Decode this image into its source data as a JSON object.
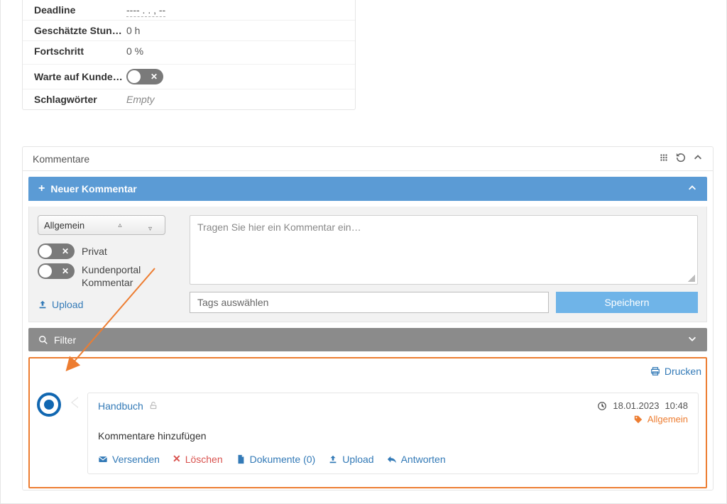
{
  "details": {
    "deadline_label": "Deadline",
    "deadline_value": "---- . . , --",
    "hours_label": "Geschätzte Stun…",
    "hours_value": "0 h",
    "progress_label": "Fortschritt",
    "progress_value": "0 %",
    "waiting_label": "Warte auf Kunde…",
    "tags_label": "Schlagwörter",
    "tags_value": "Empty"
  },
  "comments": {
    "panel_title": "Kommentare",
    "new_comment_title": "Neuer Kommentar",
    "category_selected": "Allgemein",
    "privat_label": "Privat",
    "portal_label": "Kundenportal Kommentar",
    "upload_label": "Upload",
    "textarea_placeholder": "Tragen Sie hier ein Kommentar ein…",
    "tags_placeholder": "Tags auswählen",
    "save_label": "Speichern",
    "filter_label": "Filter",
    "print_label": "Drucken"
  },
  "comment_item": {
    "author": "Handbuch",
    "date": "18.01.2023",
    "time": "10:48",
    "tag": "Allgemein",
    "body": "Kommentare hinzufügen",
    "actions": {
      "send": "Versenden",
      "delete": "Löschen",
      "documents": "Dokumente (0)",
      "upload": "Upload",
      "reply": "Antworten"
    }
  }
}
